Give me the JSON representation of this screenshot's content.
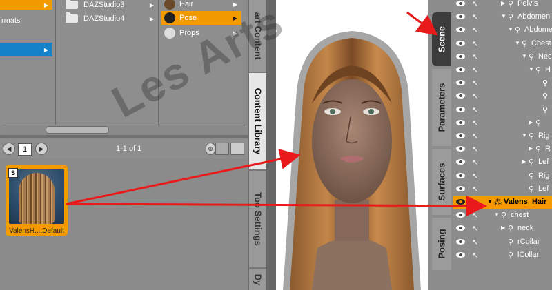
{
  "content_library": {
    "col1_items": [
      {
        "label": "",
        "state": "selected"
      },
      {
        "label": "rmats",
        "state": "normal"
      },
      {
        "label": "",
        "state": "normal"
      },
      {
        "label": "",
        "state": "blue"
      }
    ],
    "col2_items": [
      {
        "label": "DAZStudio3"
      },
      {
        "label": "DAZStudio4"
      }
    ],
    "col3_items": [
      {
        "label": "Hair",
        "state": "normal"
      },
      {
        "label": "Pose",
        "state": "selected"
      },
      {
        "label": "Props",
        "state": "normal"
      }
    ],
    "page_number": "1",
    "page_count": "1-1 of 1",
    "thumbnail_label": "ValensH....Default",
    "thumbnail_badge": "S"
  },
  "left_tabs": {
    "smart_content": "art Content",
    "content_library": "Content Library",
    "tool_settings": "Too Settings",
    "dy": "Dy"
  },
  "right_tabs": {
    "scene": "Scene",
    "parameters": "Parameters",
    "surfaces": "Surfaces",
    "posing": "Posing"
  },
  "scene_tree": [
    {
      "label": "Pelvis",
      "indent": 2,
      "expand": "right"
    },
    {
      "label": "Abdomen",
      "indent": 2,
      "expand": "down"
    },
    {
      "label": "Abdome",
      "indent": 3,
      "expand": "down"
    },
    {
      "label": "Chest",
      "indent": 4,
      "expand": "down"
    },
    {
      "label": "Nec",
      "indent": 5,
      "expand": "down"
    },
    {
      "label": "H",
      "indent": 6,
      "expand": "down"
    },
    {
      "label": "",
      "indent": 7,
      "expand": "none"
    },
    {
      "label": "",
      "indent": 7,
      "expand": "none"
    },
    {
      "label": "",
      "indent": 7,
      "expand": "none"
    },
    {
      "label": "",
      "indent": 6,
      "expand": "right"
    },
    {
      "label": "Rig",
      "indent": 5,
      "expand": "down"
    },
    {
      "label": "R",
      "indent": 6,
      "expand": "right"
    },
    {
      "label": "Lef",
      "indent": 5,
      "expand": "right"
    },
    {
      "label": "Rig",
      "indent": 5,
      "expand": "none"
    },
    {
      "label": "Lef",
      "indent": 5,
      "expand": "none"
    },
    {
      "label": "Valens_Hair",
      "indent": 0,
      "expand": "down",
      "selected": true,
      "figure": true
    },
    {
      "label": "chest",
      "indent": 1,
      "expand": "down"
    },
    {
      "label": "neck",
      "indent": 2,
      "expand": "right"
    },
    {
      "label": "rCollar",
      "indent": 2,
      "expand": "none"
    },
    {
      "label": "lCollar",
      "indent": 2,
      "expand": "none"
    }
  ],
  "watermark": "Les Arts",
  "colors": {
    "accent": "#f29a00",
    "selection_blue": "#1581c8",
    "arrow_red": "#e81a1a",
    "panel": "#8d8d8d"
  }
}
